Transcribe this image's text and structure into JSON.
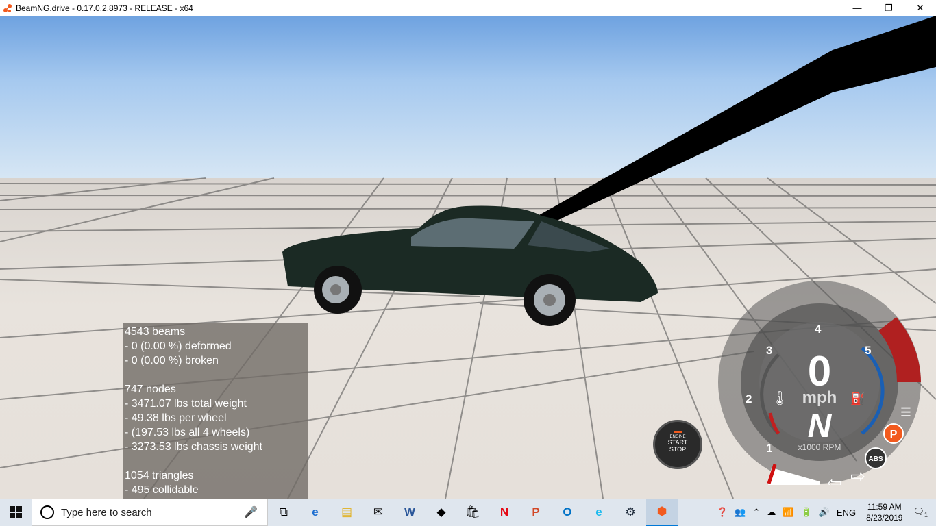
{
  "window": {
    "title": "BeamNG.drive - 0.17.0.2.8973 - RELEASE - x64",
    "icon": "beamng-logo-icon",
    "minimize": "—",
    "restore": "❐",
    "close": "✕"
  },
  "debug": {
    "lines": [
      "4543 beams",
      "- 0 (0.00 %) deformed",
      "- 0 (0.00 %) broken",
      "",
      "747 nodes",
      "- 3471.07 lbs total weight",
      "- 49.38 lbs per wheel",
      "- (197.53 lbs all 4 wheels)",
      "- 3273.53 lbs chassis weight",
      "",
      "1054 triangles",
      "- 495 collidable"
    ]
  },
  "engine_button": {
    "line1": "ENGINE",
    "line2": "START",
    "line3": "STOP"
  },
  "gauge": {
    "speed": "0",
    "unit": "mph",
    "gear": "N",
    "rpm_label": "x1000 RPM",
    "ticks": [
      "1",
      "2",
      "3",
      "4",
      "5"
    ],
    "abs": "ABS",
    "parking": "P",
    "rpm_value": 0
  },
  "taskbar": {
    "search_placeholder": "Type here to search",
    "language": "ENG",
    "time": "11:59 AM",
    "date": "8/23/2019",
    "notification_count": "1",
    "apps": [
      "task-view-icon",
      "edge-icon",
      "file-explorer-icon",
      "mail-icon",
      "word-icon",
      "dropbox-icon",
      "store-icon",
      "netflix-icon",
      "powerpoint-icon",
      "outlook-icon",
      "ie-icon",
      "steam-icon",
      "beamng-icon"
    ]
  }
}
